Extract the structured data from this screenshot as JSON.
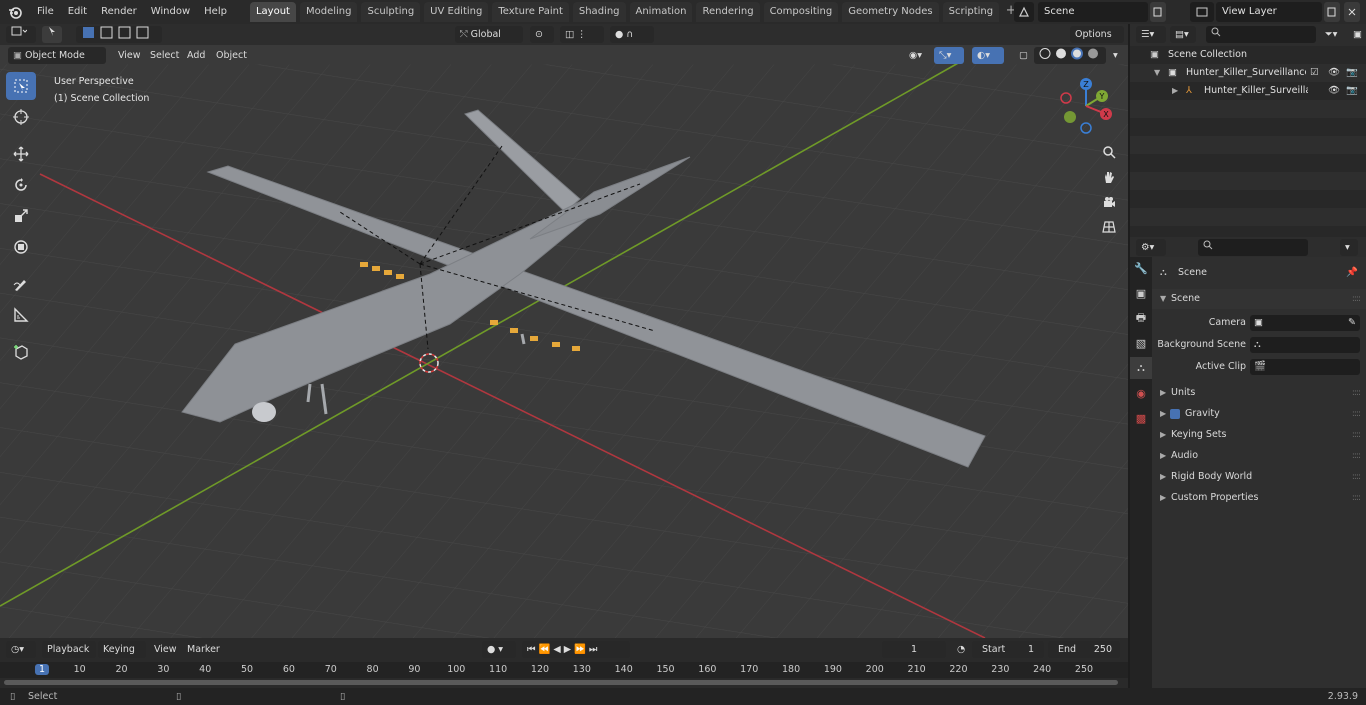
{
  "menu": [
    "File",
    "Edit",
    "Render",
    "Window",
    "Help"
  ],
  "workspaces": [
    {
      "label": "Layout",
      "active": true
    },
    {
      "label": "Modeling"
    },
    {
      "label": "Sculpting"
    },
    {
      "label": "UV Editing"
    },
    {
      "label": "Texture Paint"
    },
    {
      "label": "Shading"
    },
    {
      "label": "Animation"
    },
    {
      "label": "Rendering"
    },
    {
      "label": "Compositing"
    },
    {
      "label": "Geometry Nodes"
    },
    {
      "label": "Scripting"
    }
  ],
  "top_right": {
    "scene": "Scene",
    "view_layer": "View Layer"
  },
  "viewport_header": {
    "mode": "Object Mode",
    "view": "View",
    "select": "Select",
    "add": "Add",
    "object": "Object",
    "transform": "Global",
    "options": "Options"
  },
  "viewport_overlay": {
    "perspective": "User Perspective",
    "collection": "(1) Scene Collection"
  },
  "gizmo": {
    "z": "Z",
    "y": "Y",
    "x": "X"
  },
  "outliner": {
    "root": "Scene Collection",
    "collection": "Hunter_Killer_Surveillance_UA",
    "object": "Hunter_Killer_Surveillanc"
  },
  "properties": {
    "context": "Scene",
    "panel": "Scene",
    "camera_label": "Camera",
    "bg_scene_label": "Background Scene",
    "clip_label": "Active Clip",
    "sections": [
      "Units",
      "Gravity",
      "Keying Sets",
      "Audio",
      "Rigid Body World",
      "Custom Properties"
    ]
  },
  "timeline": {
    "playback": "Playback",
    "keying": "Keying",
    "view": "View",
    "marker": "Marker",
    "current_frame": "1",
    "start_label": "Start",
    "start": "1",
    "end_label": "End",
    "end": "250",
    "ruler": [
      "1",
      "10",
      "20",
      "30",
      "40",
      "50",
      "60",
      "70",
      "80",
      "90",
      "100",
      "110",
      "120",
      "130",
      "140",
      "150",
      "160",
      "170",
      "180",
      "190",
      "200",
      "210",
      "220",
      "230",
      "240",
      "250"
    ]
  },
  "status": {
    "select": "Select",
    "version": "2.93.9"
  },
  "colors": {
    "accent": "#4772b3",
    "x_axis": "#d03a4a",
    "y_axis": "#7fa834",
    "z_axis": "#3a7fd6"
  },
  "icons": {
    "logo": "blender-logo-icon",
    "tools": [
      "select-box-icon",
      "cursor-icon",
      "move-icon",
      "rotate-icon",
      "scale-icon",
      "transform-icon",
      "annotate-icon",
      "measure-icon",
      "add-cube-icon"
    ],
    "nav": [
      "zoom-icon",
      "pan-hand-icon",
      "camera-icon",
      "grid-view-icon"
    ]
  }
}
